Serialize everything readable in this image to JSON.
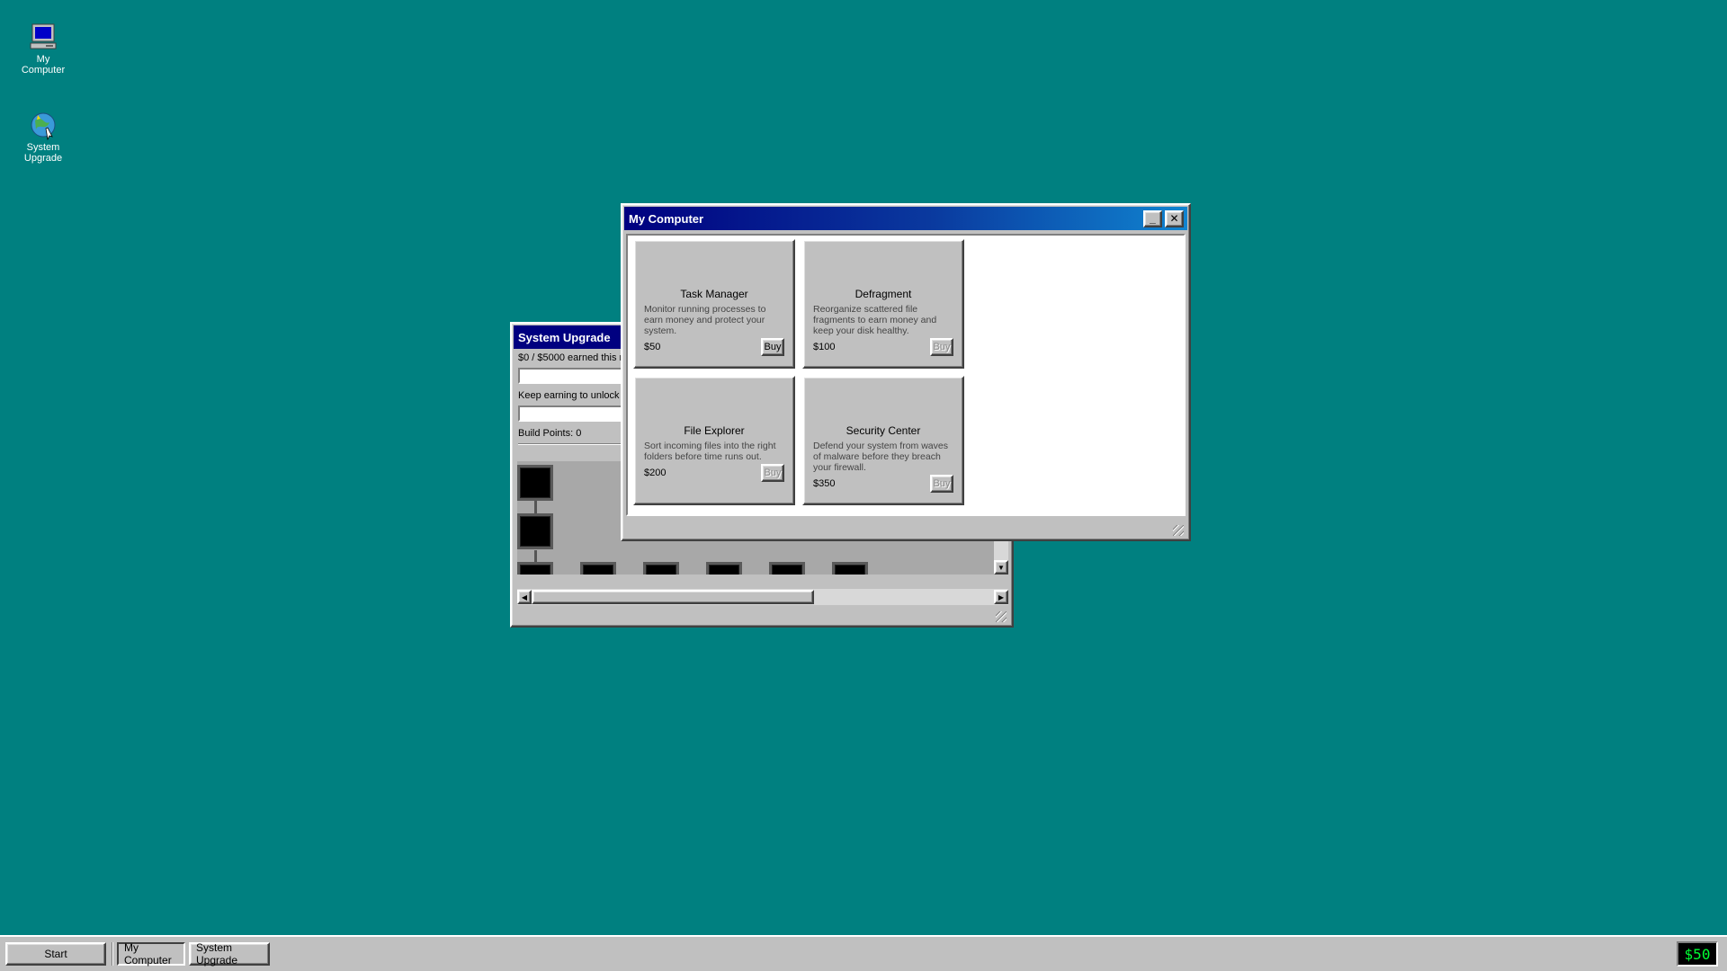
{
  "desktop": {
    "icons": [
      {
        "label": "My Computer",
        "icon": "computer-icon"
      },
      {
        "label": "System Upgrade",
        "icon": "globe-icon"
      }
    ]
  },
  "my_computer_window": {
    "title": "My Computer",
    "minimize_label": "_",
    "close_label": "✕",
    "apps": [
      {
        "name": "Task Manager",
        "description": "Monitor running processes to earn money and protect your system.",
        "price": "$50",
        "buy_label": "Buy",
        "buy_enabled": true
      },
      {
        "name": "Defragment",
        "description": "Reorganize scattered file fragments to earn money and keep your disk healthy.",
        "price": "$100",
        "buy_label": "Buy",
        "buy_enabled": false
      },
      {
        "name": "File Explorer",
        "description": "Sort incoming files into the right folders before time runs out.",
        "price": "$200",
        "buy_label": "Buy",
        "buy_enabled": false
      },
      {
        "name": "Security Center",
        "description": "Defend your system from waves of malware before they breach your firewall.",
        "price": "$350",
        "buy_label": "Buy",
        "buy_enabled": false
      }
    ]
  },
  "system_upgrade_window": {
    "title": "System Upgrade",
    "earned_text": "$0 / $5000 earned this ru",
    "unlock_text": "Keep earning to unlock F",
    "build_points": "Build Points: 0",
    "earned_progress": 0,
    "unlock_progress": 0
  },
  "taskbar": {
    "start_label": "Start",
    "tasks": [
      {
        "label": "My Computer",
        "active": true
      },
      {
        "label": "System Upgrade",
        "active": false
      }
    ],
    "money": "$50"
  },
  "colors": {
    "desktop": "#008080",
    "titlebar_active_start": "#000080",
    "titlebar_active_end": "#1084d0",
    "money_text": "#00ff33"
  }
}
